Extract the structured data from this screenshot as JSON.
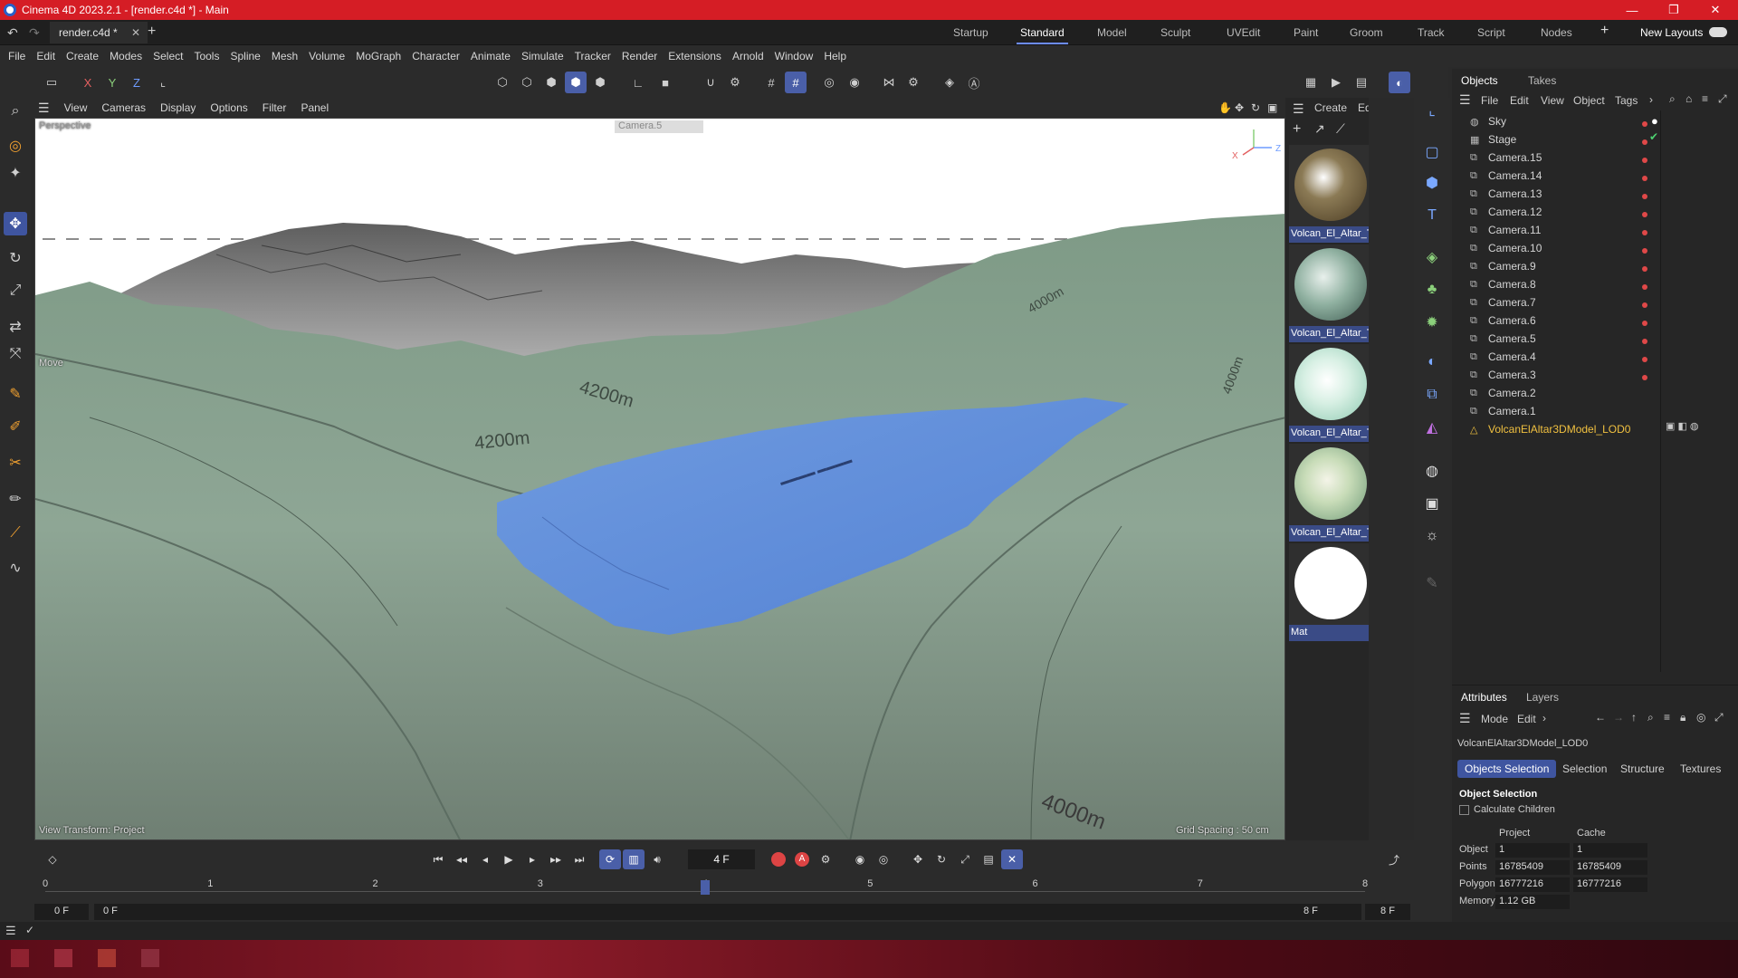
{
  "window": {
    "title": "Cinema 4D 2023.2.1 - [render.c4d *] - Main",
    "controls": [
      "—",
      "❐",
      "✕"
    ]
  },
  "tabs": {
    "doc_tab": "render.c4d *",
    "layouts": [
      "Startup",
      "Standard",
      "Model",
      "Sculpt",
      "UVEdit",
      "Paint",
      "Groom",
      "Track",
      "Script",
      "Nodes"
    ],
    "active_layout": "Standard",
    "new_layouts": "New Layouts"
  },
  "menubar": [
    "File",
    "Edit",
    "Create",
    "Modes",
    "Select",
    "Tools",
    "Spline",
    "Mesh",
    "Volume",
    "MoGraph",
    "Character",
    "Animate",
    "Simulate",
    "Tracker",
    "Render",
    "Extensions",
    "Arnold",
    "Window",
    "Help"
  ],
  "axis_buttons": {
    "x": "X",
    "y": "Y",
    "z": "Z"
  },
  "viewport_menu": [
    "View",
    "Cameras",
    "Display",
    "Options",
    "Filter",
    "Panel"
  ],
  "viewport": {
    "perspective_label": "Perspective",
    "camera_label": "Camera.5",
    "move_label": "Move",
    "view_transform": "View Transform: Project",
    "grid_spacing": "Grid Spacing : 50 cm",
    "contour_labels": [
      "4200m",
      "4200m",
      "4000m",
      "4000m",
      "4000m"
    ]
  },
  "materials_menu": {
    "create": "Create",
    "edit": "Edit"
  },
  "materials": [
    {
      "name": "Volcan_El_Altar_Te",
      "color": "#6b5a3a"
    },
    {
      "name": "Volcan_El_Altar_Te",
      "color": "#8fa8a0"
    },
    {
      "name": "Volcan_El_Altar_Te",
      "color": "#a8d4c0"
    },
    {
      "name": "Volcan_El_Altar_Te",
      "color": "#b8d0a8"
    },
    {
      "name": "Mat",
      "color": "#ffffff"
    }
  ],
  "objects_panel": {
    "tabs": [
      "Objects",
      "Takes"
    ],
    "menu": [
      "File",
      "Edit",
      "View",
      "Object",
      "Tags"
    ],
    "items": [
      {
        "name": "Sky",
        "icon": "sky-icon"
      },
      {
        "name": "Stage",
        "icon": "stage-icon"
      },
      {
        "name": "Camera.15",
        "icon": "camera-icon"
      },
      {
        "name": "Camera.14",
        "icon": "camera-icon"
      },
      {
        "name": "Camera.13",
        "icon": "camera-icon"
      },
      {
        "name": "Camera.12",
        "icon": "camera-icon"
      },
      {
        "name": "Camera.11",
        "icon": "camera-icon"
      },
      {
        "name": "Camera.10",
        "icon": "camera-icon"
      },
      {
        "name": "Camera.9",
        "icon": "camera-icon"
      },
      {
        "name": "Camera.8",
        "icon": "camera-icon"
      },
      {
        "name": "Camera.7",
        "icon": "camera-icon"
      },
      {
        "name": "Camera.6",
        "icon": "camera-icon"
      },
      {
        "name": "Camera.5",
        "icon": "camera-icon"
      },
      {
        "name": "Camera.4",
        "icon": "camera-icon"
      },
      {
        "name": "Camera.3",
        "icon": "camera-icon"
      },
      {
        "name": "Camera.2",
        "icon": "camera-icon"
      },
      {
        "name": "Camera.1",
        "icon": "camera-icon"
      },
      {
        "name": "VolcanElAltar3DModel_LOD0",
        "icon": "polygon-object-icon"
      }
    ]
  },
  "attributes_panel": {
    "tabs": [
      "Attributes",
      "Layers"
    ],
    "menu": [
      "Mode",
      "Edit"
    ],
    "object_name": "VolcanElAltar3DModel_LOD0",
    "subtabs": [
      "Objects Selection",
      "Selection",
      "Structure",
      "Textures"
    ],
    "section_title": "Object Selection",
    "calculate_children": "Calculate Children",
    "columns": [
      "Project",
      "Cache"
    ],
    "rows": [
      {
        "label": "Object",
        "project": "1",
        "cache": "1"
      },
      {
        "label": "Points",
        "project": "16785409",
        "cache": "16785409"
      },
      {
        "label": "Polygons",
        "project": "16777216",
        "cache": "16777216"
      },
      {
        "label": "Memory",
        "project": "1.12 GB",
        "cache": ""
      }
    ]
  },
  "timeline": {
    "current_frame": "4 F",
    "ticks": [
      "0",
      "1",
      "2",
      "3",
      "4",
      "5",
      "6",
      "7",
      "8"
    ],
    "start_field": "0 F",
    "start_field2": "0 F",
    "end_field": "8 F",
    "end_field2": "8 F",
    "playhead_frame": 4,
    "frame_count": 8
  }
}
